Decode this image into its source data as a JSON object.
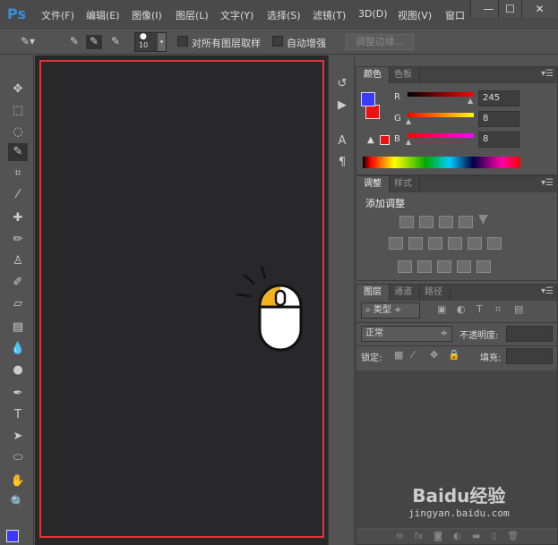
{
  "app": {
    "logo": "Ps"
  },
  "menu": [
    "文件(F)",
    "编辑(E)",
    "图像(I)",
    "图层(L)",
    "文字(Y)",
    "选择(S)",
    "滤镜(T)",
    "3D(D)",
    "视图(V)",
    "窗口"
  ],
  "window": {
    "minimize": "—",
    "maximize": "☐",
    "close": "✕"
  },
  "options": {
    "brush_size": "10",
    "sample_all_layers": "对所有图层取样",
    "auto_enhance": "自动增强",
    "refine_edge": "调整边缘..."
  },
  "color_panel": {
    "tabs": [
      "颜色",
      "色板"
    ],
    "r_label": "R",
    "g_label": "G",
    "b_label": "B",
    "r": "245",
    "g": "8",
    "b": "8",
    "fg": "#3a3aff",
    "bg": "#ee1111"
  },
  "adjust_panel": {
    "tabs": [
      "调整",
      "样式"
    ],
    "title": "添加调整"
  },
  "layers_panel": {
    "tabs": [
      "图层",
      "通道",
      "路径"
    ],
    "filter": "类型",
    "blend": "正常",
    "opacity_label": "不透明度:",
    "lock_label": "锁定:",
    "fill_label": "填充:"
  },
  "watermark": {
    "brand": "Baidu经验",
    "url": "jingyan.baidu.com"
  }
}
